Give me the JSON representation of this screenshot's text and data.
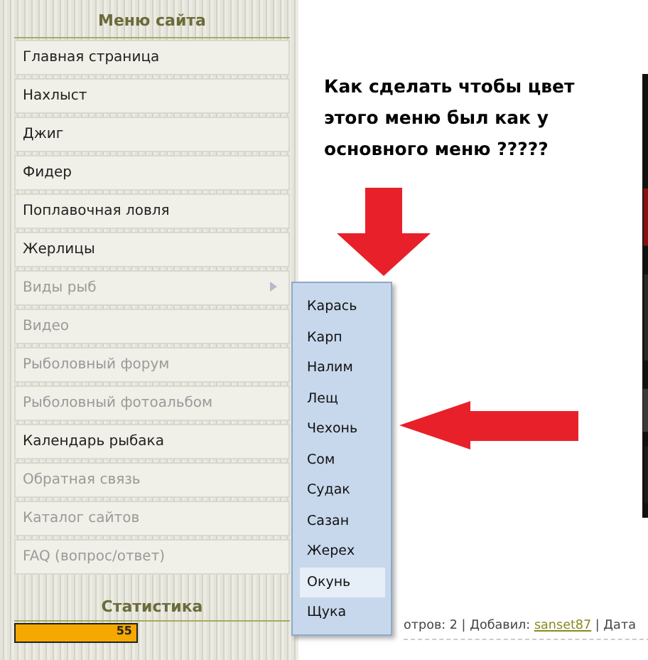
{
  "sidebar": {
    "title": "Меню сайта",
    "items": [
      {
        "label": "Главная страница",
        "dimmed": false,
        "has_submenu": false
      },
      {
        "label": "Нахлыст",
        "dimmed": false,
        "has_submenu": false
      },
      {
        "label": "Джиг",
        "dimmed": false,
        "has_submenu": false
      },
      {
        "label": "Фидер",
        "dimmed": false,
        "has_submenu": false
      },
      {
        "label": "Поплавочная ловля",
        "dimmed": false,
        "has_submenu": false
      },
      {
        "label": "Жерлицы",
        "dimmed": false,
        "has_submenu": false
      },
      {
        "label": "Виды рыб",
        "dimmed": true,
        "has_submenu": true
      },
      {
        "label": "Видео",
        "dimmed": true,
        "has_submenu": false
      },
      {
        "label": "Рыболовный форум",
        "dimmed": true,
        "has_submenu": false
      },
      {
        "label": "Рыболовный фотоальбом",
        "dimmed": true,
        "has_submenu": false
      },
      {
        "label": "Календарь рыбака",
        "dimmed": false,
        "has_submenu": false
      },
      {
        "label": "Обратная связь",
        "dimmed": true,
        "has_submenu": false
      },
      {
        "label": "Каталог сайтов",
        "dimmed": true,
        "has_submenu": false
      },
      {
        "label": "FAQ (вопрос/ответ)",
        "dimmed": true,
        "has_submenu": false
      }
    ],
    "stats_title": "Статистика",
    "counter": "55"
  },
  "submenu": {
    "items": [
      {
        "label": "Карась",
        "selected": false
      },
      {
        "label": "Карп",
        "selected": false
      },
      {
        "label": "Налим",
        "selected": false
      },
      {
        "label": "Лещ",
        "selected": false
      },
      {
        "label": "Чехонь",
        "selected": false
      },
      {
        "label": "Сом",
        "selected": false
      },
      {
        "label": "Судак",
        "selected": false
      },
      {
        "label": "Сазан",
        "selected": false
      },
      {
        "label": "Жерех",
        "selected": false
      },
      {
        "label": "Окунь",
        "selected": true
      },
      {
        "label": "Щука",
        "selected": false
      }
    ]
  },
  "question": "Как сделать чтобы цвет этого меню был как у основного меню ?????",
  "footer": {
    "before": "отров: 2 | Добавил: ",
    "author": "sanset87",
    "after": " | Дата"
  }
}
